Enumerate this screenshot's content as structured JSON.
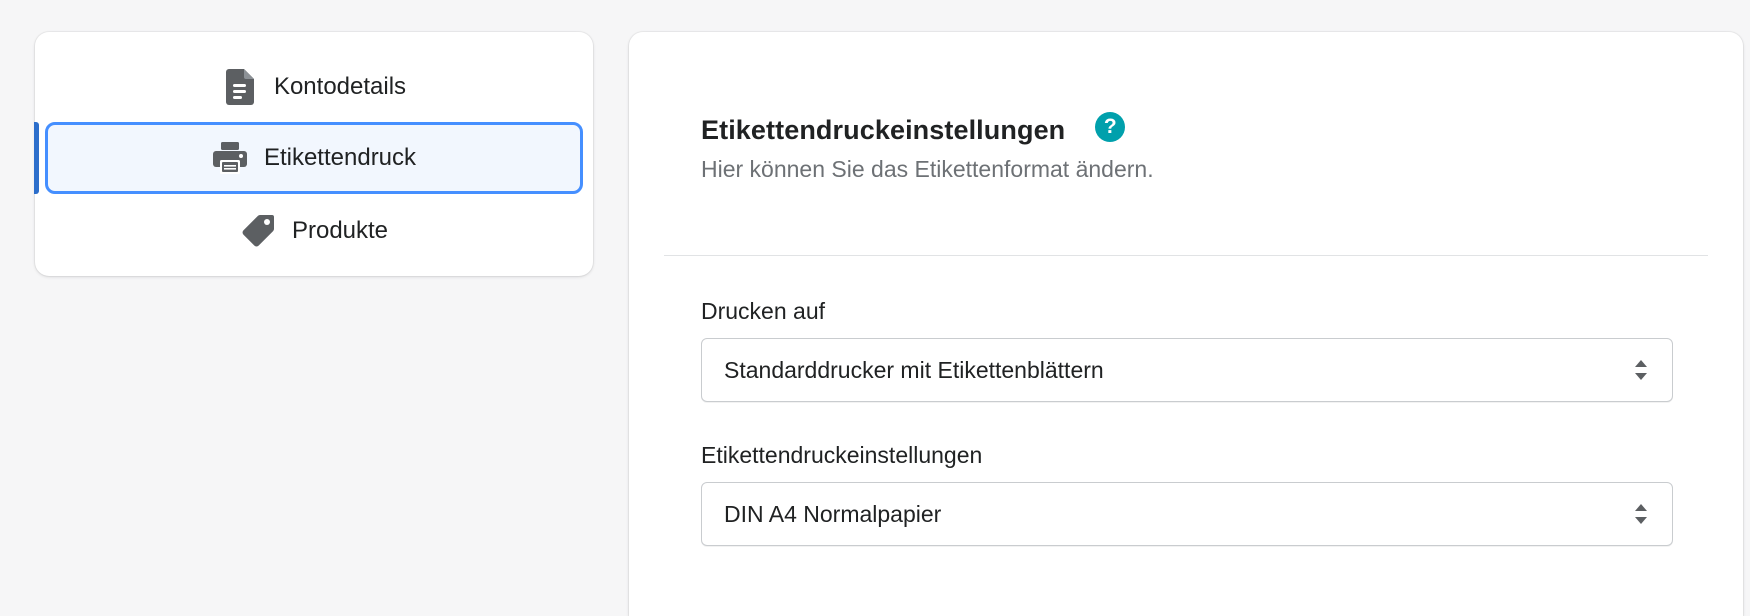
{
  "nav": {
    "items": [
      {
        "label": "Kontodetails",
        "icon": "document-icon"
      },
      {
        "label": "Etikettendruck",
        "icon": "printer-icon",
        "selected": true
      },
      {
        "label": "Produkte",
        "icon": "tag-icon"
      }
    ]
  },
  "settings": {
    "title": "Etikettendruckeinstellungen",
    "help_icon": "?",
    "subtitle": "Hier können Sie das Etikettenformat ändern.",
    "fields": [
      {
        "label": "Drucken auf",
        "value": "Standarddrucker mit Etikettenblättern"
      },
      {
        "label": "Etikettendruckeinstellungen",
        "value": "DIN A4 Normalpapier"
      }
    ]
  },
  "colors": {
    "accent": "#2c6ecb",
    "focus_border": "#458fff",
    "selected_bg": "#f2f7fe",
    "help": "#00a0ac",
    "icon": "#5c5f62"
  }
}
